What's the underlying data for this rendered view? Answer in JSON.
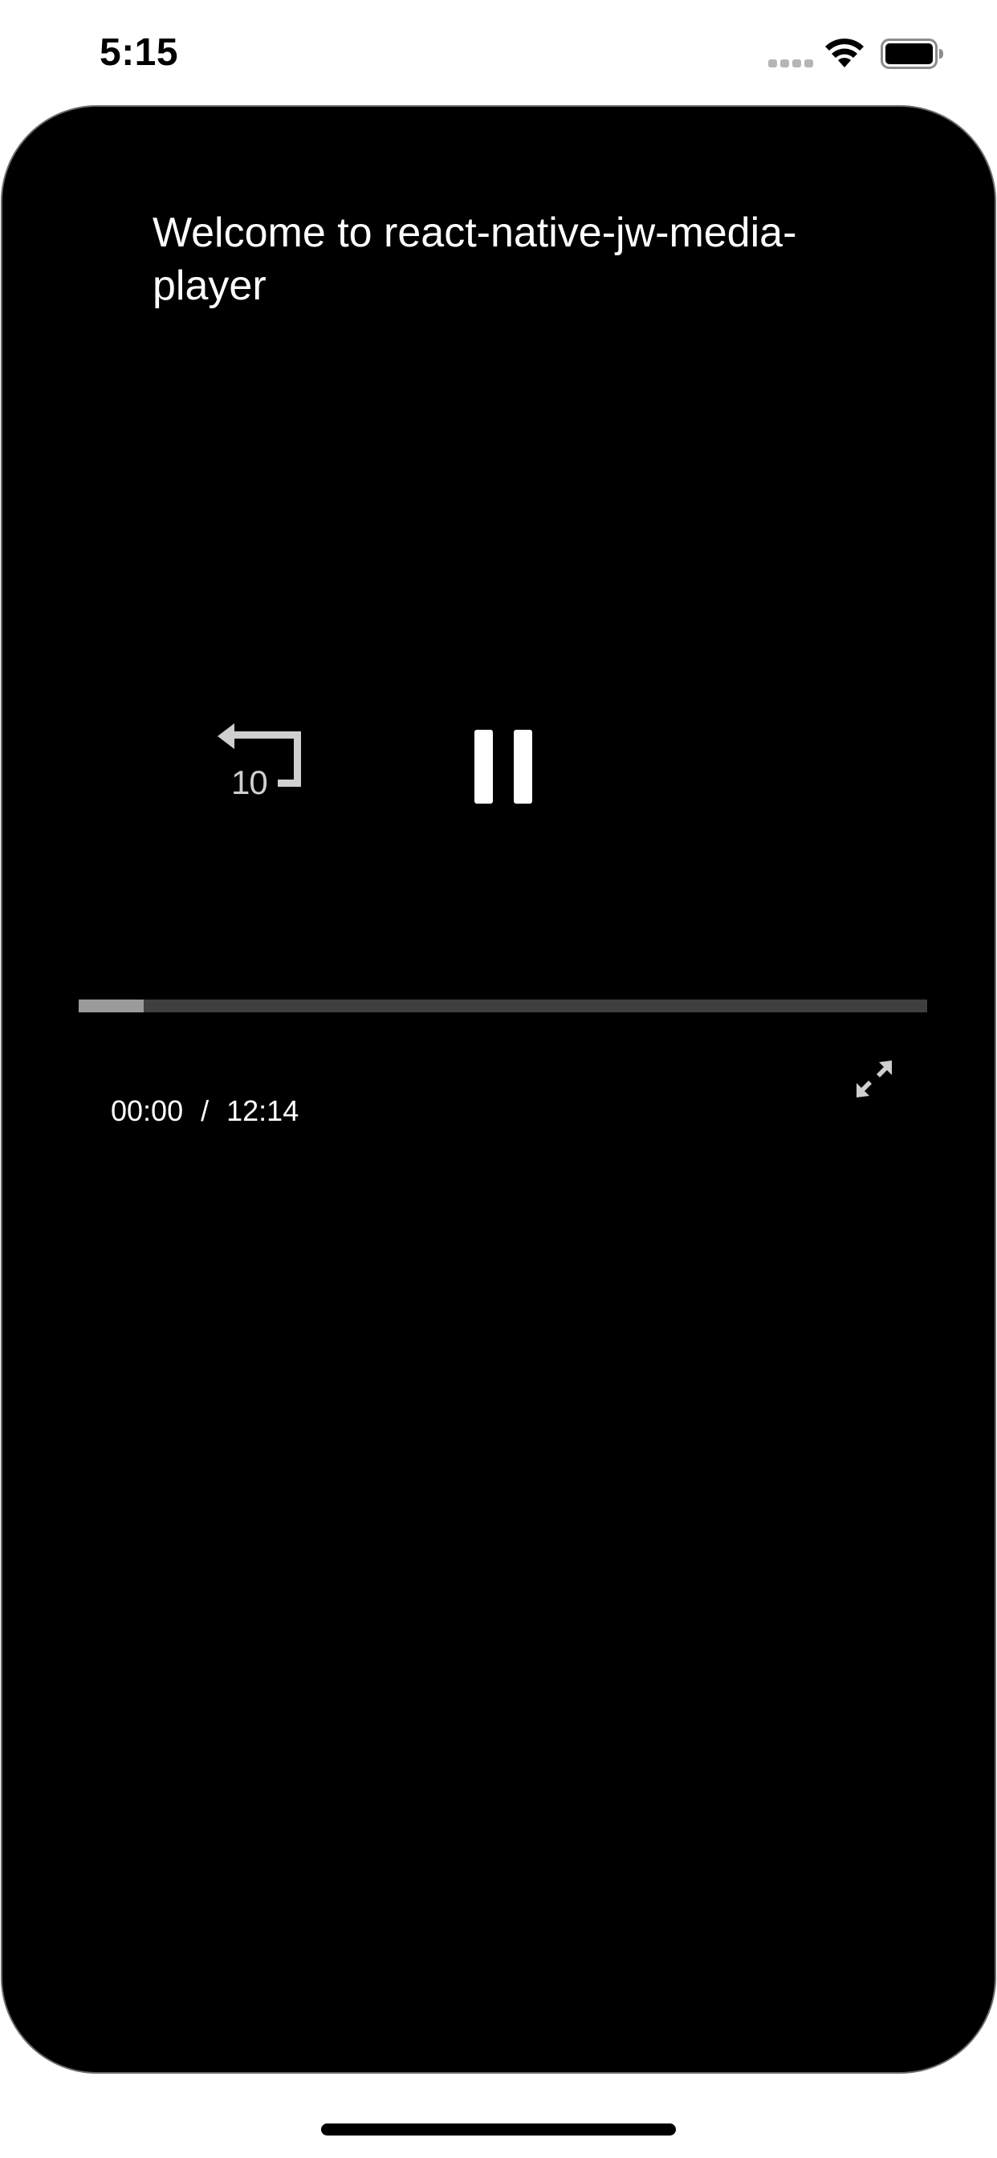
{
  "status_bar": {
    "time": "5:15",
    "icons": [
      "signal-dots-icon",
      "wifi-icon",
      "battery-icon"
    ]
  },
  "player": {
    "title": "Welcome to react-native-jw-media-player",
    "rewind": {
      "icon": "rewind-10-icon",
      "label": "10"
    },
    "pause": {
      "icon": "pause-icon"
    },
    "progress": {
      "fraction": 0.077
    },
    "current_time": "00:00",
    "separator": "/",
    "duration": "12:14",
    "fullscreen": {
      "icon": "fullscreen-expand-icon"
    }
  },
  "colors": {
    "background": "#000000",
    "text": "#ffffff",
    "track": "#3f3f3f",
    "progress_fill": "#9a9a9a",
    "icon_grey": "#cfcfcf"
  }
}
